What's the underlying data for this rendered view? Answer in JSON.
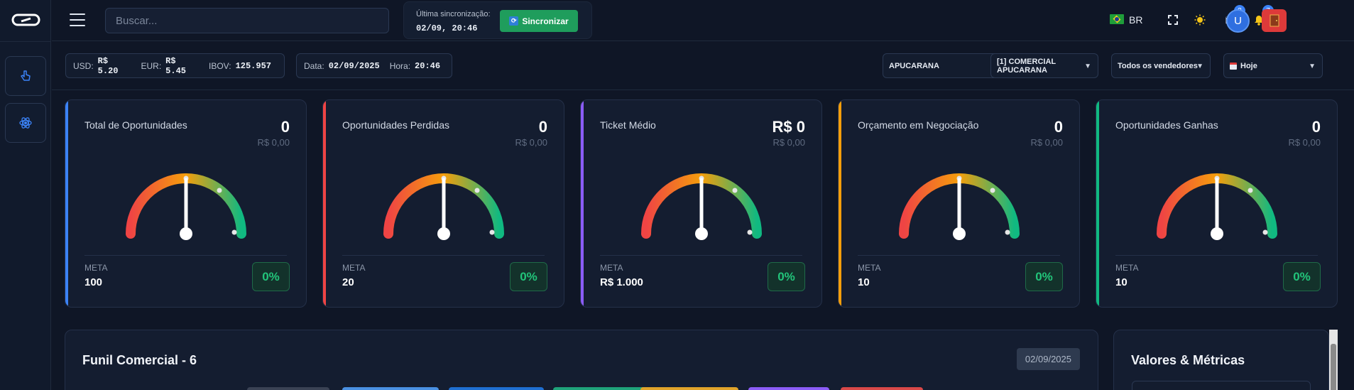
{
  "header": {
    "search_placeholder": "Buscar...",
    "sync_label": "Última sincronização:",
    "sync_time": "02/09, 20:46",
    "sync_button": "Sincronizar",
    "language": "BR",
    "messages_count": "3",
    "notifications_count": "7",
    "avatar_initial": "U"
  },
  "market": {
    "usd_label": "USD:",
    "usd_value": "R$ 5.20",
    "eur_label": "EUR:",
    "eur_value": "R$ 5.45",
    "ibov_label": "IBOV:",
    "ibov_value": "125.957"
  },
  "datetime": {
    "date_label": "Data:",
    "date_value": "02/09/2025",
    "time_label": "Hora:",
    "time_value": "20:46"
  },
  "filters": {
    "city": "APUCARANA",
    "store": "[1] COMERCIAL APUCARANA",
    "seller": "Todos os vendedores",
    "period": "Hoje"
  },
  "cards": [
    {
      "title": "Total de Oportunidades",
      "value": "0",
      "sub": "R$ 0,00",
      "meta_label": "META",
      "meta_value": "100",
      "percent": "0%",
      "accent": "#3b82f6"
    },
    {
      "title": "Oportunidades Perdidas",
      "value": "0",
      "sub": "R$ 0,00",
      "meta_label": "META",
      "meta_value": "20",
      "percent": "0%",
      "accent": "#ef4444"
    },
    {
      "title": "Ticket Médio",
      "value": "R$ 0",
      "sub": "R$ 0,00",
      "meta_label": "META",
      "meta_value": "R$ 1.000",
      "percent": "0%",
      "accent": "#8b5cf6"
    },
    {
      "title": "Orçamento em Negociação",
      "value": "0",
      "sub": "R$ 0,00",
      "meta_label": "META",
      "meta_value": "10",
      "percent": "0%",
      "accent": "#f59e0b"
    },
    {
      "title": "Oportunidades Ganhas",
      "value": "0",
      "sub": "R$ 0,00",
      "meta_label": "META",
      "meta_value": "10",
      "percent": "0%",
      "accent": "#10b981"
    }
  ],
  "funnel": {
    "title": "Funil Comercial - 6",
    "date": "02/09/2025",
    "stage_colors": [
      "#3a4254",
      "#4a90e2",
      "#1f6fd1",
      "#1fa37a",
      "#e0a32a",
      "#8b5cf6",
      "#d94848"
    ]
  },
  "metrics": {
    "title": "Valores & Métricas"
  },
  "colors": {
    "background": "#0f1626",
    "card": "#141d30",
    "success": "#22c47a",
    "sync_button": "#1f9d5c",
    "exit_button": "#dd3a3a"
  }
}
